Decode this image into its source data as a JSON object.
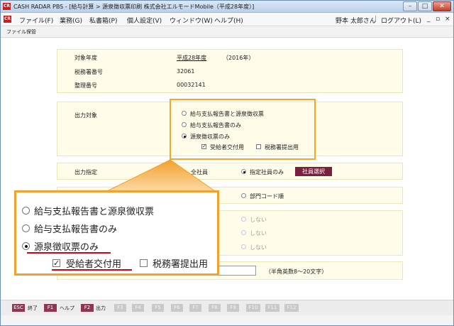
{
  "window": {
    "icon_text": "CR",
    "title": "CASH RADAR PBS - [給与計算 > 源泉徴収票印刷 株式会社エルモードMobile（平成28年度）]",
    "min": "–",
    "max": "□",
    "close": "✕"
  },
  "menubar": {
    "icon_text": "CR",
    "items": [
      "ファイル(F)",
      "業務(G)",
      "私書箱(P)",
      "個人設定(V)",
      "ウィンドウ(W)",
      "ヘルプ(H)"
    ],
    "user": "野本 太郎さん",
    "separator": "|",
    "logout": "ログアウト(L)",
    "ctrl_min": "_",
    "ctrl_restore": "▫",
    "ctrl_close": "×"
  },
  "toolbar": {
    "label": "ファイル保管"
  },
  "info": {
    "target_year_label": "対象年度",
    "target_year_value": "平成28年度",
    "target_year_ad": "（2016年）",
    "tax_office_label": "税務署番号",
    "tax_office_value": "32061",
    "ref_label": "整理番号",
    "ref_value": "00032141"
  },
  "output_target": {
    "label": "出力対象",
    "options": [
      "給与支払報告書と源泉徴収票",
      "給与支払報告書のみ",
      "源泉徴収票のみ"
    ],
    "selected_index": 2,
    "recipient": "受給者交付用",
    "recipient_checked": true,
    "tax_office": "税務署提出用",
    "tax_office_checked": false
  },
  "output_spec": {
    "label": "出力指定",
    "opt_all": "全社員",
    "opt_specified": "指定社員のみ",
    "select_button": "社員選択"
  },
  "order": {
    "department": "部門コード順"
  },
  "flags": [
    "しない",
    "しない",
    "しない"
  ],
  "password_hint": "（半角英数8～20文字）",
  "fkeys": [
    {
      "key": "ESC",
      "label": "終了",
      "enabled": true
    },
    {
      "key": "F1",
      "label": "ヘルプ",
      "enabled": true
    },
    {
      "key": "F2",
      "label": "出力",
      "enabled": true
    },
    {
      "key": "F3",
      "label": "",
      "enabled": false
    },
    {
      "key": "F4",
      "label": "",
      "enabled": false
    },
    {
      "key": "F5",
      "label": "",
      "enabled": false
    },
    {
      "key": "F6",
      "label": "",
      "enabled": false
    },
    {
      "key": "F7",
      "label": "",
      "enabled": false
    },
    {
      "key": "F8",
      "label": "",
      "enabled": false
    },
    {
      "key": "F9",
      "label": "",
      "enabled": false
    },
    {
      "key": "F10",
      "label": "",
      "enabled": false
    },
    {
      "key": "F11",
      "label": "",
      "enabled": false
    },
    {
      "key": "F12",
      "label": "",
      "enabled": false
    }
  ],
  "colors": {
    "highlight": "#f5a623",
    "underline": "#d0021b",
    "button": "#7a1f3e"
  }
}
